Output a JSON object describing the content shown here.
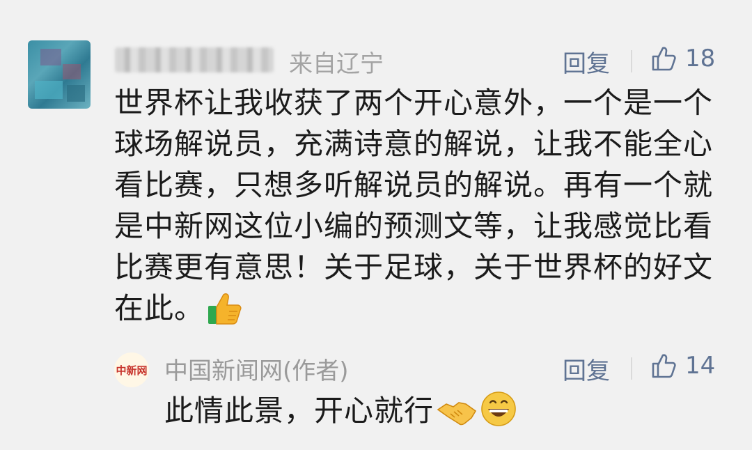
{
  "comment": {
    "username": "",
    "location": "来自辽宁",
    "reply_label": "回复",
    "like_count": "18",
    "text": "世界杯让我收获了两个开心意外，一个是一个球场解说员，充满诗意的解说，让我不能全心看比赛，只想多听解说员的解说。再有一个就是中新网这位小编的预测文等，让我感觉比看比赛更有意思！关于足球，关于世界杯的好文在此。",
    "emoji": "thumbs-up-icon"
  },
  "author_reply": {
    "avatar_text": "中新网",
    "name": "中国新闻网(作者)",
    "reply_label": "回复",
    "like_count": "14",
    "text": "此情此景，开心就行",
    "emojis": [
      "handshake-icon",
      "grinning-face-icon"
    ]
  },
  "colors": {
    "background": "#f1f1f1",
    "meta_gray": "#a3a3a3",
    "action_blue": "#5f7393",
    "text": "#1b1b1b"
  }
}
